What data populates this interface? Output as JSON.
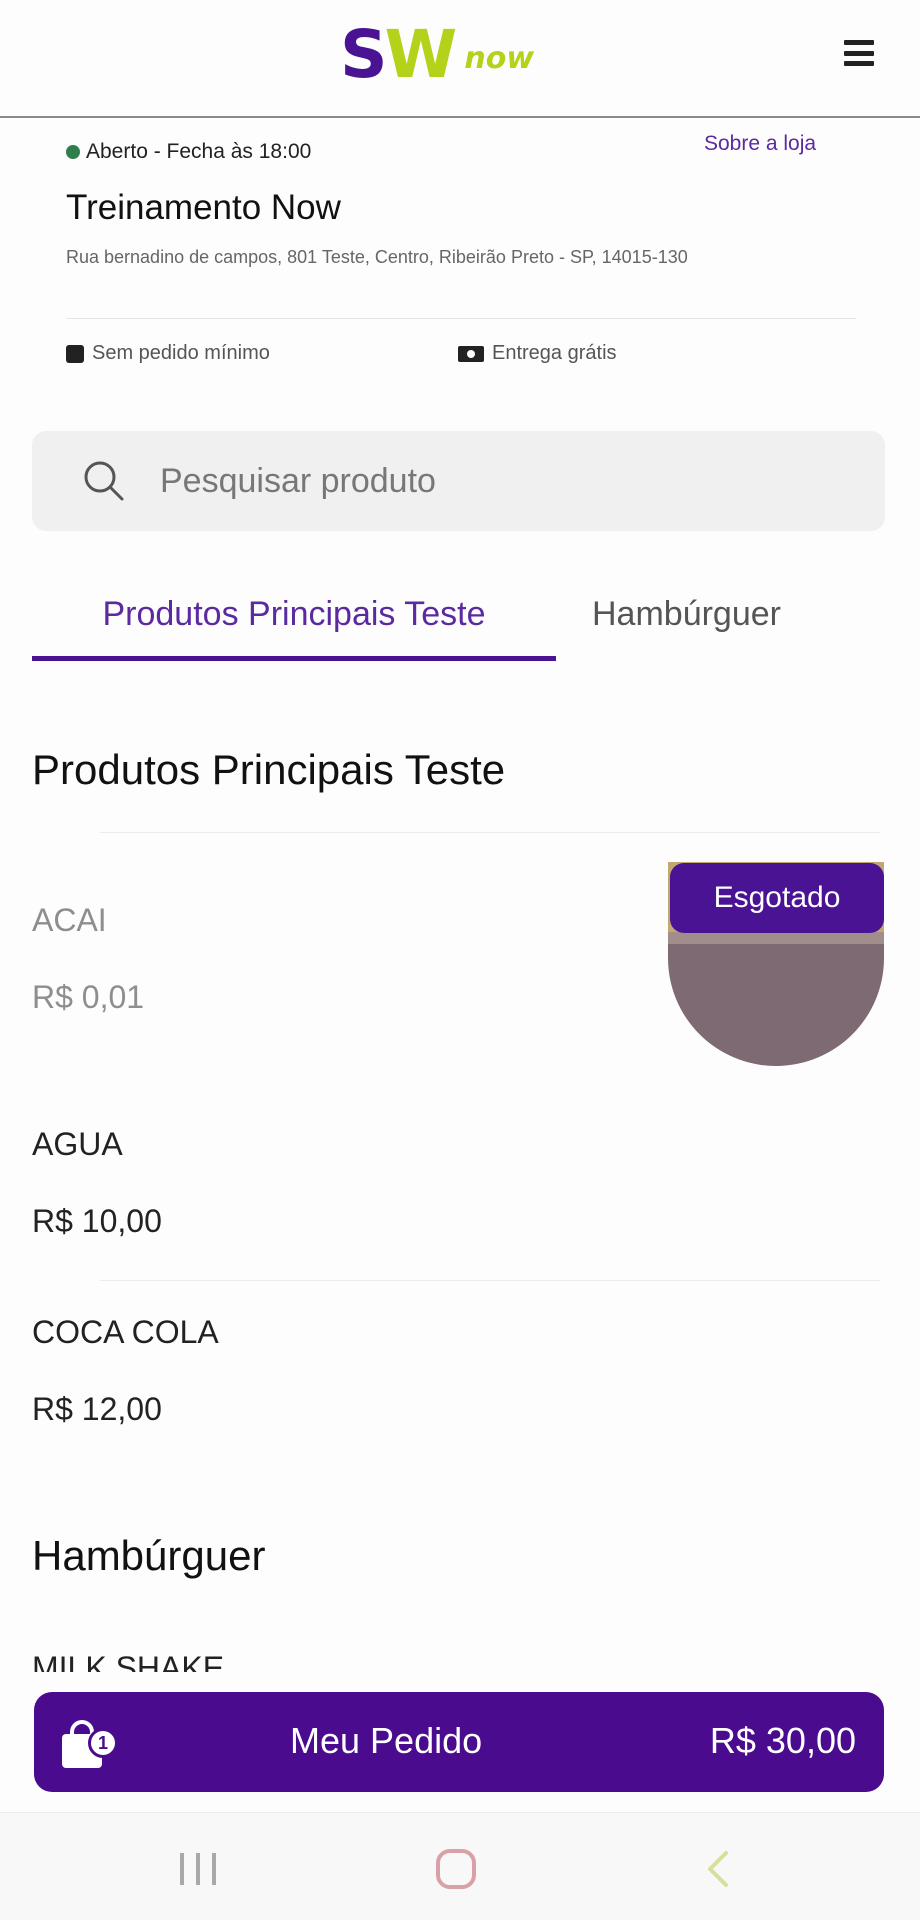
{
  "header": {
    "logo_main_s": "S",
    "logo_main_w": "W",
    "logo_sub": "now"
  },
  "store": {
    "status": "Aberto - Fecha às 18:00",
    "about_link": "Sobre a loja",
    "name": "Treinamento Now",
    "address": "Rua bernadino de campos, 801 Teste, Centro, Ribeirão Preto - SP, 14015-130",
    "min_order": "Sem pedido mínimo",
    "delivery": "Entrega grátis"
  },
  "search": {
    "placeholder": "Pesquisar produto"
  },
  "tabs": [
    {
      "label": "Produtos Principais Teste",
      "active": true
    },
    {
      "label": "Hambúrguer",
      "active": false
    }
  ],
  "sections": [
    {
      "title": "Produtos Principais Teste",
      "products": [
        {
          "name": "ACAI",
          "price": "R$ 0,01",
          "badge": "Esgotado"
        },
        {
          "name": "AGUA",
          "price": "R$ 10,00"
        },
        {
          "name": "COCA COLA",
          "price": "R$ 12,00"
        }
      ]
    },
    {
      "title": "Hambúrguer",
      "products": [
        {
          "name": "MILK SHAKE"
        }
      ]
    }
  ],
  "cart": {
    "count": "1",
    "label": "Meu Pedido",
    "total": "R$ 30,00"
  },
  "colors": {
    "brand_purple": "#4a1394",
    "brand_green": "#b5d21b",
    "open_status": "#2e7d4a"
  }
}
